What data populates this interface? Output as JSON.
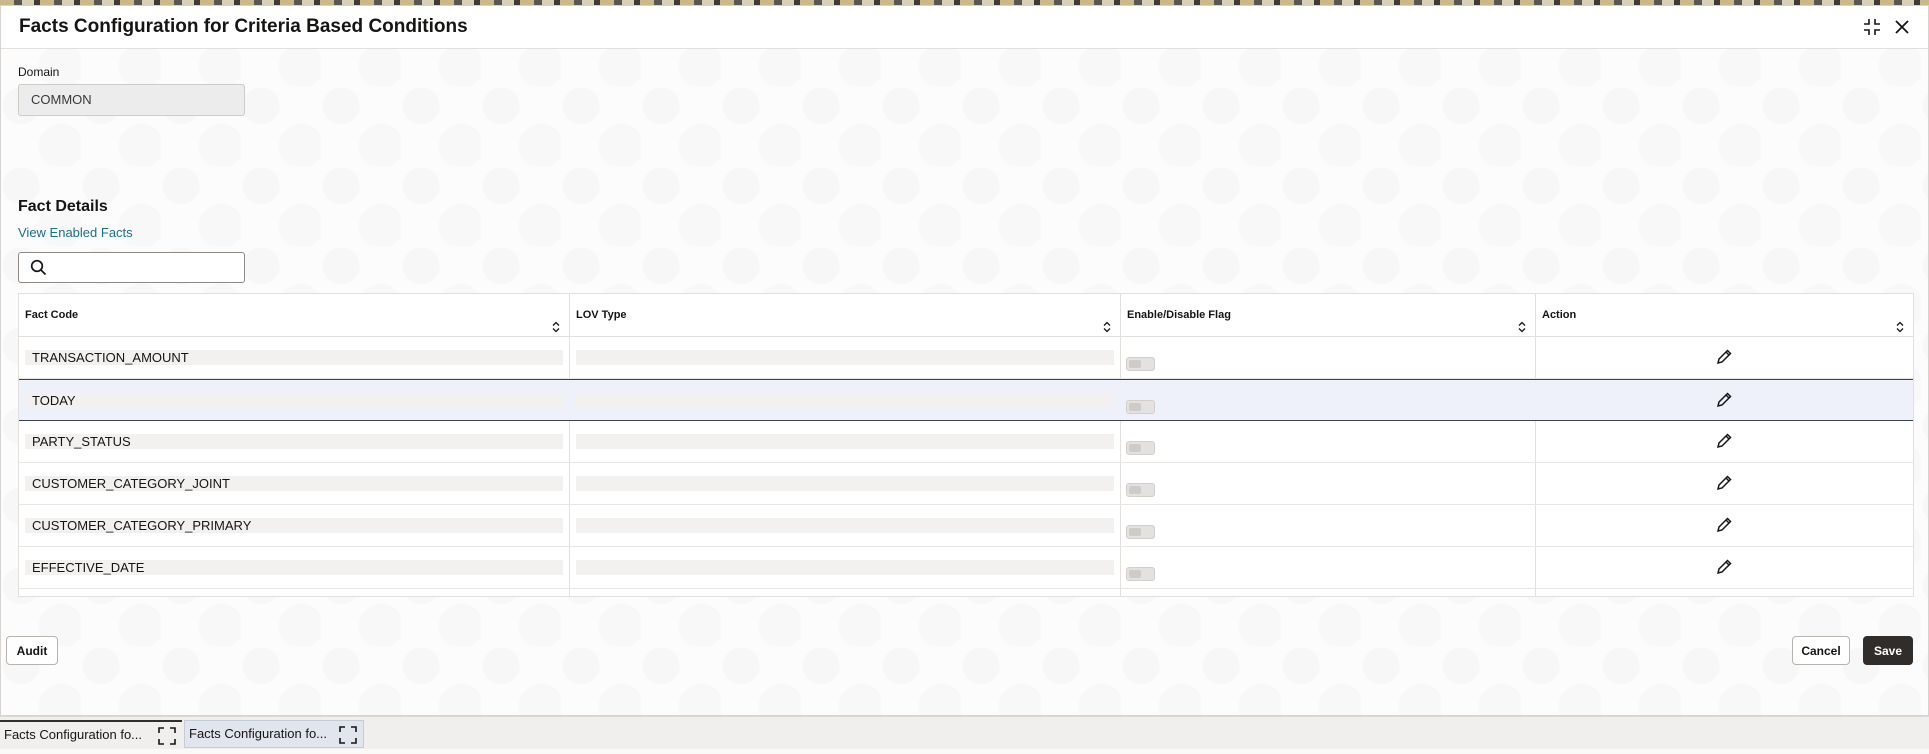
{
  "dialog": {
    "title": "Facts Configuration for Criteria Based Conditions"
  },
  "domain": {
    "label": "Domain",
    "value": "COMMON"
  },
  "fact_details": {
    "title": "Fact Details",
    "link": "View Enabled Facts",
    "search_placeholder": ""
  },
  "table": {
    "columns": [
      "Fact Code",
      "LOV Type",
      "Enable/Disable Flag",
      "Action"
    ],
    "rows": [
      {
        "fact_code": "TRANSACTION_AMOUNT",
        "lov_type": "",
        "enabled": false
      },
      {
        "fact_code": "TODAY",
        "lov_type": "",
        "enabled": false
      },
      {
        "fact_code": "PARTY_STATUS",
        "lov_type": "",
        "enabled": false
      },
      {
        "fact_code": "CUSTOMER_CATEGORY_JOINT",
        "lov_type": "",
        "enabled": false
      },
      {
        "fact_code": "CUSTOMER_CATEGORY_PRIMARY",
        "lov_type": "",
        "enabled": false
      },
      {
        "fact_code": "EFFECTIVE_DATE",
        "lov_type": "",
        "enabled": false
      }
    ],
    "selected_row": 1
  },
  "footer": {
    "audit": "Audit",
    "cancel": "Cancel",
    "save": "Save"
  },
  "taskbar": {
    "tabs": [
      {
        "label": "Facts Configuration fo..."
      },
      {
        "label": "Facts Configuration fo..."
      }
    ]
  },
  "icons": {
    "maximize": "compress-icon",
    "close": "close-icon",
    "search": "search-icon",
    "sort": "sort-icon",
    "edit": "pencil-icon"
  }
}
